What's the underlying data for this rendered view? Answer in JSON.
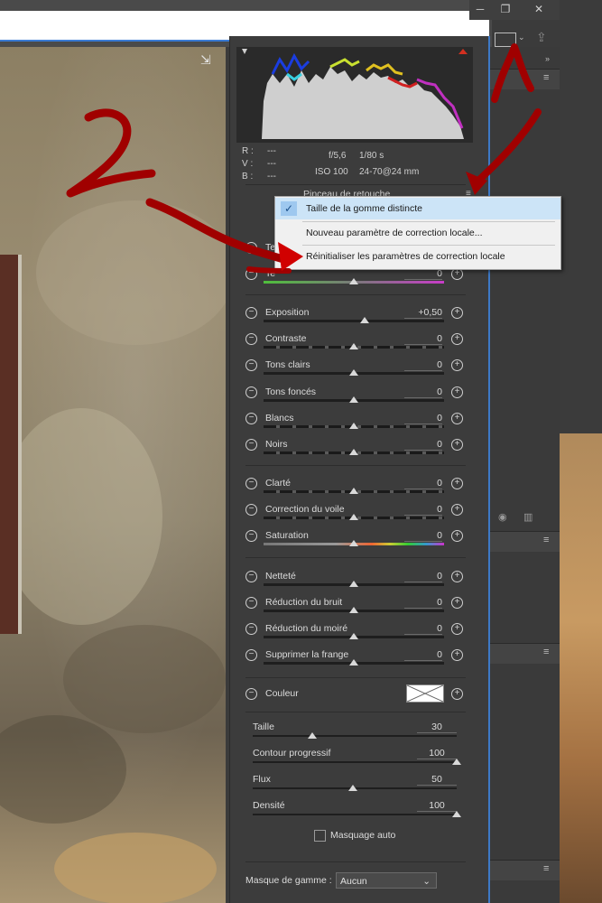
{
  "window": {
    "minimize_icon": "minus-icon",
    "restore_icon": "restore-icon",
    "close_icon": "close-icon"
  },
  "toolbar": {
    "view_icon": "panel-view-icon",
    "share_icon": "share-icon"
  },
  "readout": {
    "r_label": "R :",
    "v_label": "V :",
    "b_label": "B :",
    "r_value": "---",
    "v_value": "---",
    "b_value": "---",
    "aperture": "f/5,6",
    "shutter": "1/80 s",
    "iso": "ISO 100",
    "lens": "24-70@24 mm"
  },
  "panel": {
    "tool_title": "Pinceau de retouche",
    "partial_label_1": "Te",
    "partial_label_2": "Te",
    "first_value": "0"
  },
  "sliders_group1": [
    {
      "label": "Exposition",
      "value": "+0,50",
      "pos": 0.56
    },
    {
      "label": "Contraste",
      "value": "0",
      "pos": 0.5
    },
    {
      "label": "Tons clairs",
      "value": "0",
      "pos": 0.5
    },
    {
      "label": "Tons foncés",
      "value": "0",
      "pos": 0.5
    },
    {
      "label": "Blancs",
      "value": "0",
      "pos": 0.5
    },
    {
      "label": "Noirs",
      "value": "0",
      "pos": 0.5
    }
  ],
  "sliders_group2": [
    {
      "label": "Clarté",
      "value": "0",
      "pos": 0.5
    },
    {
      "label": "Correction du voile",
      "value": "0",
      "pos": 0.5
    },
    {
      "label": "Saturation",
      "value": "0",
      "pos": 0.5
    }
  ],
  "sliders_group3": [
    {
      "label": "Netteté",
      "value": "0",
      "pos": 0.5
    },
    {
      "label": "Réduction du bruit",
      "value": "0",
      "pos": 0.5
    },
    {
      "label": "Réduction du moiré",
      "value": "0",
      "pos": 0.5
    },
    {
      "label": "Supprimer la frange",
      "value": "0",
      "pos": 0.5
    }
  ],
  "color": {
    "label": "Couleur"
  },
  "brush": [
    {
      "label": "Taille",
      "value": "30",
      "pos": 0.29
    },
    {
      "label": "Contour progressif",
      "value": "100",
      "pos": 1.0
    },
    {
      "label": "Flux",
      "value": "50",
      "pos": 0.49
    },
    {
      "label": "Densité",
      "value": "100",
      "pos": 1.0
    }
  ],
  "auto_mask": {
    "label": "Masquage auto",
    "checked": false
  },
  "range_mask": {
    "label": "Masque de gamme :",
    "selected": "Aucun"
  },
  "menu": {
    "items": [
      {
        "label": "Taille de la gomme distincte",
        "checked": true
      },
      {
        "label": "Nouveau paramètre de correction locale..."
      },
      {
        "label": "Réinitialiser les paramètres de correction locale"
      }
    ]
  },
  "annotation": {
    "number": "2"
  },
  "colors": {
    "accent": "#3d79c6",
    "annotation": "#a00000",
    "menu_highlight": "#cce4f7"
  }
}
